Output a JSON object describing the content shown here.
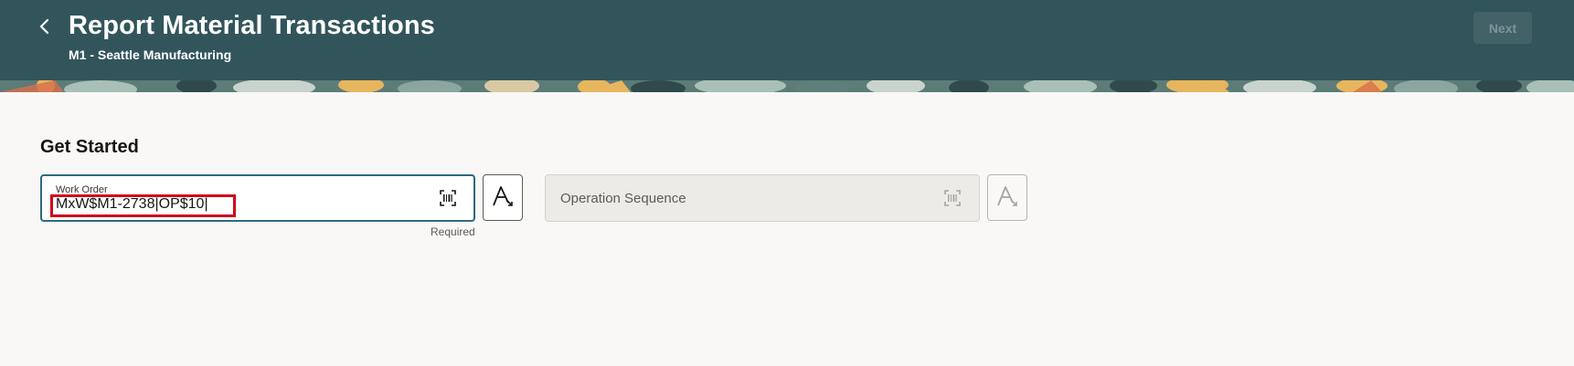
{
  "header": {
    "title": "Report Material Transactions",
    "subtitle": "M1 - Seattle Manufacturing",
    "back_icon": "chevron-left-icon",
    "next_label": "Next"
  },
  "content": {
    "section_title": "Get Started",
    "work_order": {
      "label": "Work Order",
      "value": "MxW$M1-2738|OP$10|",
      "required_text": "Required",
      "barcode_icon": "barcode-scan-icon"
    },
    "operation_sequence": {
      "placeholder": "Operation Sequence",
      "barcode_icon": "barcode-scan-icon"
    },
    "ocr_icon": "text-recognition-icon"
  },
  "colors": {
    "header_bg": "#32555b",
    "page_bg": "#f9f8f6",
    "focus_border": "#2c6a81",
    "highlight": "#d0021b",
    "banner_accent": "#e6b55e"
  }
}
